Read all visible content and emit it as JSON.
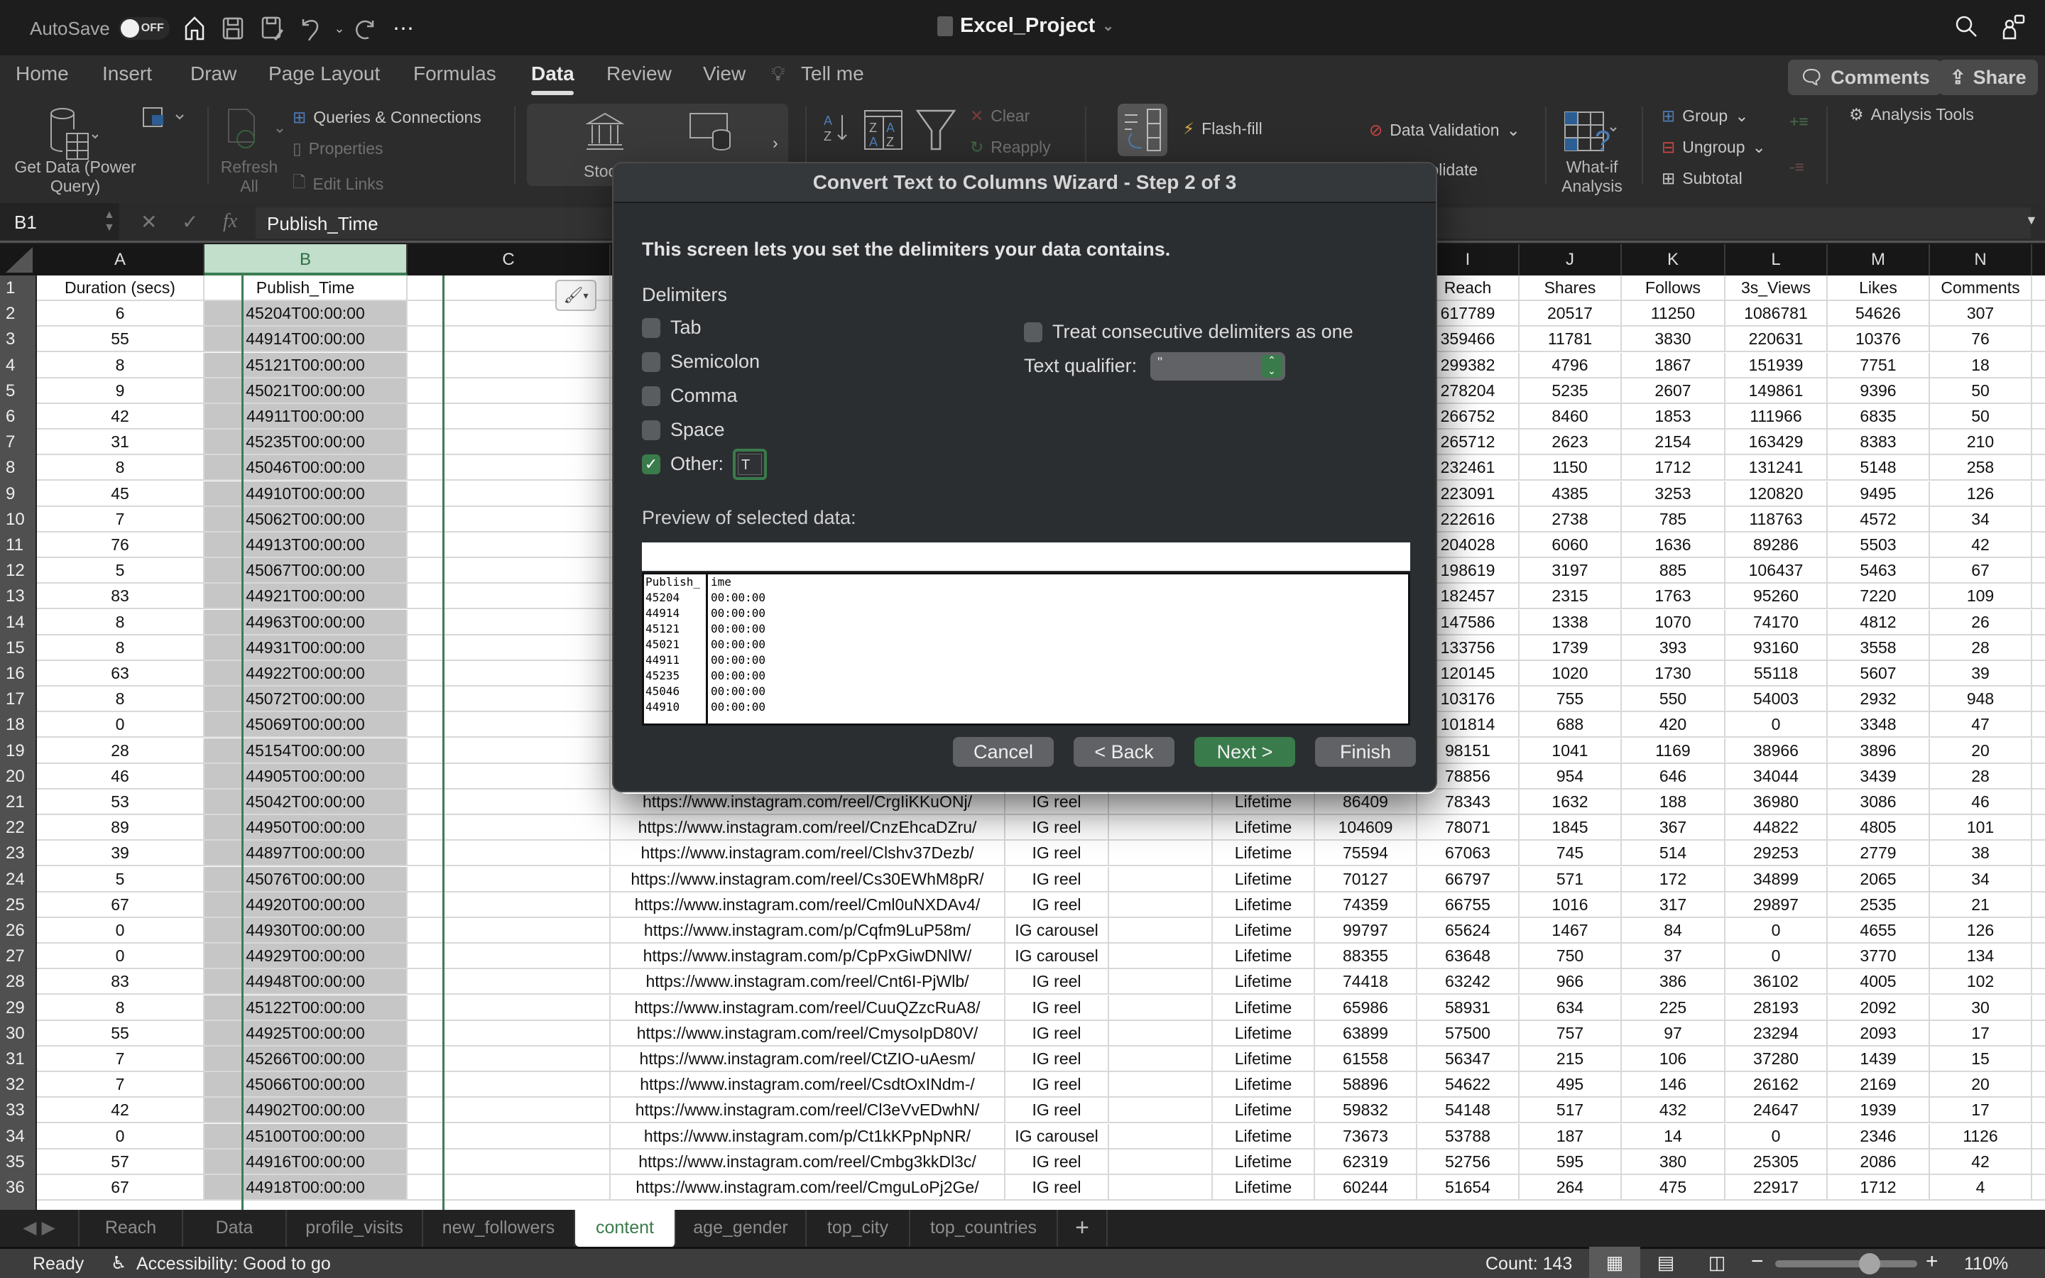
{
  "titlebar": {
    "autosave_label": "AutoSave",
    "autosave_state": "OFF",
    "doc_title": "Excel_Project"
  },
  "menu": {
    "tabs": [
      "Home",
      "Insert",
      "Draw",
      "Page Layout",
      "Formulas",
      "Data",
      "Review",
      "View",
      "Tell me"
    ],
    "active": "Data",
    "comments_label": "Comments",
    "share_label": "Share"
  },
  "ribbon": {
    "get_data": "Get Data (Power Query)",
    "refresh_all": "Refresh All",
    "queries_connections": "Queries & Connections",
    "properties": "Properties",
    "edit_links": "Edit Links",
    "stocks": "Stocks",
    "clear": "Clear",
    "reapply": "Reapply",
    "flash_fill": "Flash-fill",
    "data_validation": "Data Validation",
    "consolidate": "Consolidate",
    "what_if": "What-if Analysis",
    "group": "Group",
    "ungroup": "Ungroup",
    "subtotal": "Subtotal",
    "analysis_tools": "Analysis Tools"
  },
  "formula_bar": {
    "name_box": "B1",
    "content": "Publish_Time"
  },
  "grid": {
    "left_columns": [
      "A",
      "B",
      "C"
    ],
    "right_columns": [
      "I",
      "J",
      "K",
      "L",
      "M",
      "N"
    ],
    "header_row": {
      "A": "Duration (secs)",
      "B": "Publish_Time",
      "I": "Reach",
      "J": "Shares",
      "K": "Follows",
      "L": "3s_Views",
      "M": "Likes",
      "N": "Comments"
    },
    "rows_top": [
      {
        "n": 2,
        "A": "6",
        "B": "45204T00:00:00",
        "I": "617789",
        "J": "20517",
        "K": "11250",
        "L": "1086781",
        "M": "54626",
        "N": "307"
      },
      {
        "n": 3,
        "A": "55",
        "B": "44914T00:00:00",
        "I": "359466",
        "J": "11781",
        "K": "3830",
        "L": "220631",
        "M": "10376",
        "N": "76"
      },
      {
        "n": 4,
        "A": "8",
        "B": "45121T00:00:00",
        "I": "299382",
        "J": "4796",
        "K": "1867",
        "L": "151939",
        "M": "7751",
        "N": "18"
      },
      {
        "n": 5,
        "A": "9",
        "B": "45021T00:00:00",
        "I": "278204",
        "J": "5235",
        "K": "2607",
        "L": "149861",
        "M": "9396",
        "N": "50"
      },
      {
        "n": 6,
        "A": "42",
        "B": "44911T00:00:00",
        "I": "266752",
        "J": "8460",
        "K": "1853",
        "L": "111966",
        "M": "6835",
        "N": "50"
      },
      {
        "n": 7,
        "A": "31",
        "B": "45235T00:00:00",
        "I": "265712",
        "J": "2623",
        "K": "2154",
        "L": "163429",
        "M": "8383",
        "N": "210"
      },
      {
        "n": 8,
        "A": "8",
        "B": "45046T00:00:00",
        "I": "232461",
        "J": "1150",
        "K": "1712",
        "L": "131241",
        "M": "5148",
        "N": "258"
      },
      {
        "n": 9,
        "A": "45",
        "B": "44910T00:00:00",
        "I": "223091",
        "J": "4385",
        "K": "3253",
        "L": "120820",
        "M": "9495",
        "N": "126"
      },
      {
        "n": 10,
        "A": "7",
        "B": "45062T00:00:00",
        "I": "222616",
        "J": "2738",
        "K": "785",
        "L": "118763",
        "M": "4572",
        "N": "34"
      },
      {
        "n": 11,
        "A": "76",
        "B": "44913T00:00:00",
        "I": "204028",
        "J": "6060",
        "K": "1636",
        "L": "89286",
        "M": "5503",
        "N": "42"
      },
      {
        "n": 12,
        "A": "5",
        "B": "45067T00:00:00",
        "I": "198619",
        "J": "3197",
        "K": "885",
        "L": "106437",
        "M": "5463",
        "N": "67"
      },
      {
        "n": 13,
        "A": "83",
        "B": "44921T00:00:00",
        "I": "182457",
        "J": "2315",
        "K": "1763",
        "L": "95260",
        "M": "7220",
        "N": "109"
      },
      {
        "n": 14,
        "A": "8",
        "B": "44963T00:00:00",
        "I": "147586",
        "J": "1338",
        "K": "1070",
        "L": "74170",
        "M": "4812",
        "N": "26"
      },
      {
        "n": 15,
        "A": "8",
        "B": "44931T00:00:00",
        "I": "133756",
        "J": "1739",
        "K": "393",
        "L": "93160",
        "M": "3558",
        "N": "28"
      },
      {
        "n": 16,
        "A": "63",
        "B": "44922T00:00:00",
        "I": "120145",
        "J": "1020",
        "K": "1730",
        "L": "55118",
        "M": "5607",
        "N": "39"
      },
      {
        "n": 17,
        "A": "8",
        "B": "45072T00:00:00",
        "I": "103176",
        "J": "755",
        "K": "550",
        "L": "54003",
        "M": "2932",
        "N": "948"
      },
      {
        "n": 18,
        "A": "0",
        "B": "45069T00:00:00",
        "I": "101814",
        "J": "688",
        "K": "420",
        "L": "0",
        "M": "3348",
        "N": "47"
      },
      {
        "n": 19,
        "A": "28",
        "B": "45154T00:00:00",
        "I": "98151",
        "J": "1041",
        "K": "1169",
        "L": "38966",
        "M": "3896",
        "N": "20"
      },
      {
        "n": 20,
        "A": "46",
        "B": "44905T00:00:00",
        "I": "78856",
        "J": "954",
        "K": "646",
        "L": "34044",
        "M": "3439",
        "N": "28"
      }
    ],
    "rows_bottom": [
      {
        "n": 21,
        "A": "53",
        "B": "45042T00:00:00",
        "D": "https://www.instagram.com/reel/CrgIiKKuONj/",
        "E": "IG reel",
        "G": "Lifetime",
        "H": "86409",
        "I": "78343",
        "J": "1632",
        "K": "188",
        "L": "36980",
        "M": "3086",
        "N": "46"
      },
      {
        "n": 22,
        "A": "89",
        "B": "44950T00:00:00",
        "D": "https://www.instagram.com/reel/CnzEhcaDZru/",
        "E": "IG reel",
        "G": "Lifetime",
        "H": "104609",
        "I": "78071",
        "J": "1845",
        "K": "367",
        "L": "44822",
        "M": "4805",
        "N": "101"
      },
      {
        "n": 23,
        "A": "39",
        "B": "44897T00:00:00",
        "D": "https://www.instagram.com/reel/Clshv37Dezb/",
        "E": "IG reel",
        "G": "Lifetime",
        "H": "75594",
        "I": "67063",
        "J": "745",
        "K": "514",
        "L": "29253",
        "M": "2779",
        "N": "38"
      },
      {
        "n": 24,
        "A": "5",
        "B": "45076T00:00:00",
        "D": "https://www.instagram.com/reel/Cs30EWhM8pR/",
        "E": "IG reel",
        "G": "Lifetime",
        "H": "70127",
        "I": "66797",
        "J": "571",
        "K": "172",
        "L": "34899",
        "M": "2065",
        "N": "34"
      },
      {
        "n": 25,
        "A": "67",
        "B": "44920T00:00:00",
        "D": "https://www.instagram.com/reel/Cml0uNXDAv4/",
        "E": "IG reel",
        "G": "Lifetime",
        "H": "74359",
        "I": "66755",
        "J": "1016",
        "K": "317",
        "L": "29897",
        "M": "2535",
        "N": "21"
      },
      {
        "n": 26,
        "A": "0",
        "B": "44930T00:00:00",
        "D": "https://www.instagram.com/p/Cqfm9LuP58m/",
        "E": "IG carousel",
        "G": "Lifetime",
        "H": "99797",
        "I": "65624",
        "J": "1467",
        "K": "84",
        "L": "0",
        "M": "4655",
        "N": "126"
      },
      {
        "n": 27,
        "A": "0",
        "B": "44929T00:00:00",
        "D": "https://www.instagram.com/p/CpPxGiwDNlW/",
        "E": "IG carousel",
        "G": "Lifetime",
        "H": "88355",
        "I": "63648",
        "J": "750",
        "K": "37",
        "L": "0",
        "M": "3770",
        "N": "134"
      },
      {
        "n": 28,
        "A": "83",
        "B": "44948T00:00:00",
        "D": "https://www.instagram.com/reel/Cnt6I-PjWlb/",
        "E": "IG reel",
        "G": "Lifetime",
        "H": "74418",
        "I": "63242",
        "J": "966",
        "K": "386",
        "L": "36102",
        "M": "4005",
        "N": "102"
      },
      {
        "n": 29,
        "A": "8",
        "B": "45122T00:00:00",
        "D": "https://www.instagram.com/reel/CuuQZzcRuA8/",
        "E": "IG reel",
        "G": "Lifetime",
        "H": "65986",
        "I": "58931",
        "J": "634",
        "K": "225",
        "L": "28193",
        "M": "2092",
        "N": "30"
      },
      {
        "n": 30,
        "A": "55",
        "B": "44925T00:00:00",
        "D": "https://www.instagram.com/reel/CmysoIpD80V/",
        "E": "IG reel",
        "G": "Lifetime",
        "H": "63899",
        "I": "57500",
        "J": "757",
        "K": "97",
        "L": "23294",
        "M": "2093",
        "N": "17"
      },
      {
        "n": 31,
        "A": "7",
        "B": "45266T00:00:00",
        "D": "https://www.instagram.com/reel/CtZIO-uAesm/",
        "E": "IG reel",
        "G": "Lifetime",
        "H": "61558",
        "I": "56347",
        "J": "215",
        "K": "106",
        "L": "37280",
        "M": "1439",
        "N": "15"
      },
      {
        "n": 32,
        "A": "7",
        "B": "45066T00:00:00",
        "D": "https://www.instagram.com/reel/CsdtOxINdm-/",
        "E": "IG reel",
        "G": "Lifetime",
        "H": "58896",
        "I": "54622",
        "J": "495",
        "K": "146",
        "L": "26162",
        "M": "2169",
        "N": "20"
      },
      {
        "n": 33,
        "A": "42",
        "B": "44902T00:00:00",
        "D": "https://www.instagram.com/reel/Cl3eVvEDwhN/",
        "E": "IG reel",
        "G": "Lifetime",
        "H": "59832",
        "I": "54148",
        "J": "517",
        "K": "432",
        "L": "24647",
        "M": "1939",
        "N": "17"
      },
      {
        "n": 34,
        "A": "0",
        "B": "45100T00:00:00",
        "D": "https://www.instagram.com/p/Ct1kKPpNpNR/",
        "E": "IG carousel",
        "G": "Lifetime",
        "H": "73673",
        "I": "53788",
        "J": "187",
        "K": "14",
        "L": "0",
        "M": "2346",
        "N": "1126"
      },
      {
        "n": 35,
        "A": "57",
        "B": "44916T00:00:00",
        "D": "https://www.instagram.com/reel/Cmbg3kkDl3c/",
        "E": "IG reel",
        "G": "Lifetime",
        "H": "62319",
        "I": "52756",
        "J": "595",
        "K": "380",
        "L": "25305",
        "M": "2086",
        "N": "42"
      },
      {
        "n": 36,
        "A": "67",
        "B": "44918T00:00:00",
        "D": "https://www.instagram.com/reel/CmguLoPj2Ge/",
        "E": "IG reel",
        "G": "Lifetime",
        "H": "60244",
        "I": "51654",
        "J": "264",
        "K": "475",
        "L": "22917",
        "M": "1712",
        "N": "4"
      }
    ]
  },
  "dialog": {
    "title": "Convert Text to Columns Wizard - Step 2 of 3",
    "intro": "This screen lets you set the delimiters your data contains.",
    "delimiters_label": "Delimiters",
    "options": [
      {
        "label": "Tab",
        "checked": false
      },
      {
        "label": "Semicolon",
        "checked": false
      },
      {
        "label": "Comma",
        "checked": false
      },
      {
        "label": "Space",
        "checked": false
      },
      {
        "label": "Other:",
        "checked": true
      }
    ],
    "other_value": "T",
    "consecutive_label": "Treat consecutive delimiters as one",
    "consecutive_checked": false,
    "qualifier_label": "Text qualifier:",
    "qualifier_value": "\"",
    "preview_label": "Preview of selected data:",
    "preview_col1": [
      "Publish_",
      "45204",
      "44914",
      "45121",
      "45021",
      "44911",
      "45235",
      "45046",
      "44910"
    ],
    "preview_col2": [
      "ime",
      "00:00:00",
      "00:00:00",
      "00:00:00",
      "00:00:00",
      "00:00:00",
      "00:00:00",
      "00:00:00",
      "00:00:00"
    ],
    "buttons": {
      "cancel": "Cancel",
      "back": "< Back",
      "next": "Next >",
      "finish": "Finish"
    }
  },
  "sheet_tabs": {
    "tabs": [
      "Reach",
      "Data",
      "profile_visits",
      "new_followers",
      "content",
      "age_gender",
      "top_city",
      "top_countries"
    ],
    "active": "content"
  },
  "status": {
    "ready": "Ready",
    "accessibility": "Accessibility: Good to go",
    "count": "Count: 143",
    "zoom": "110%",
    "zoom_level_percent": 110
  },
  "colors": {
    "accent_green": "#3a7b4b",
    "selected_column_header": "#c1dfcb"
  }
}
